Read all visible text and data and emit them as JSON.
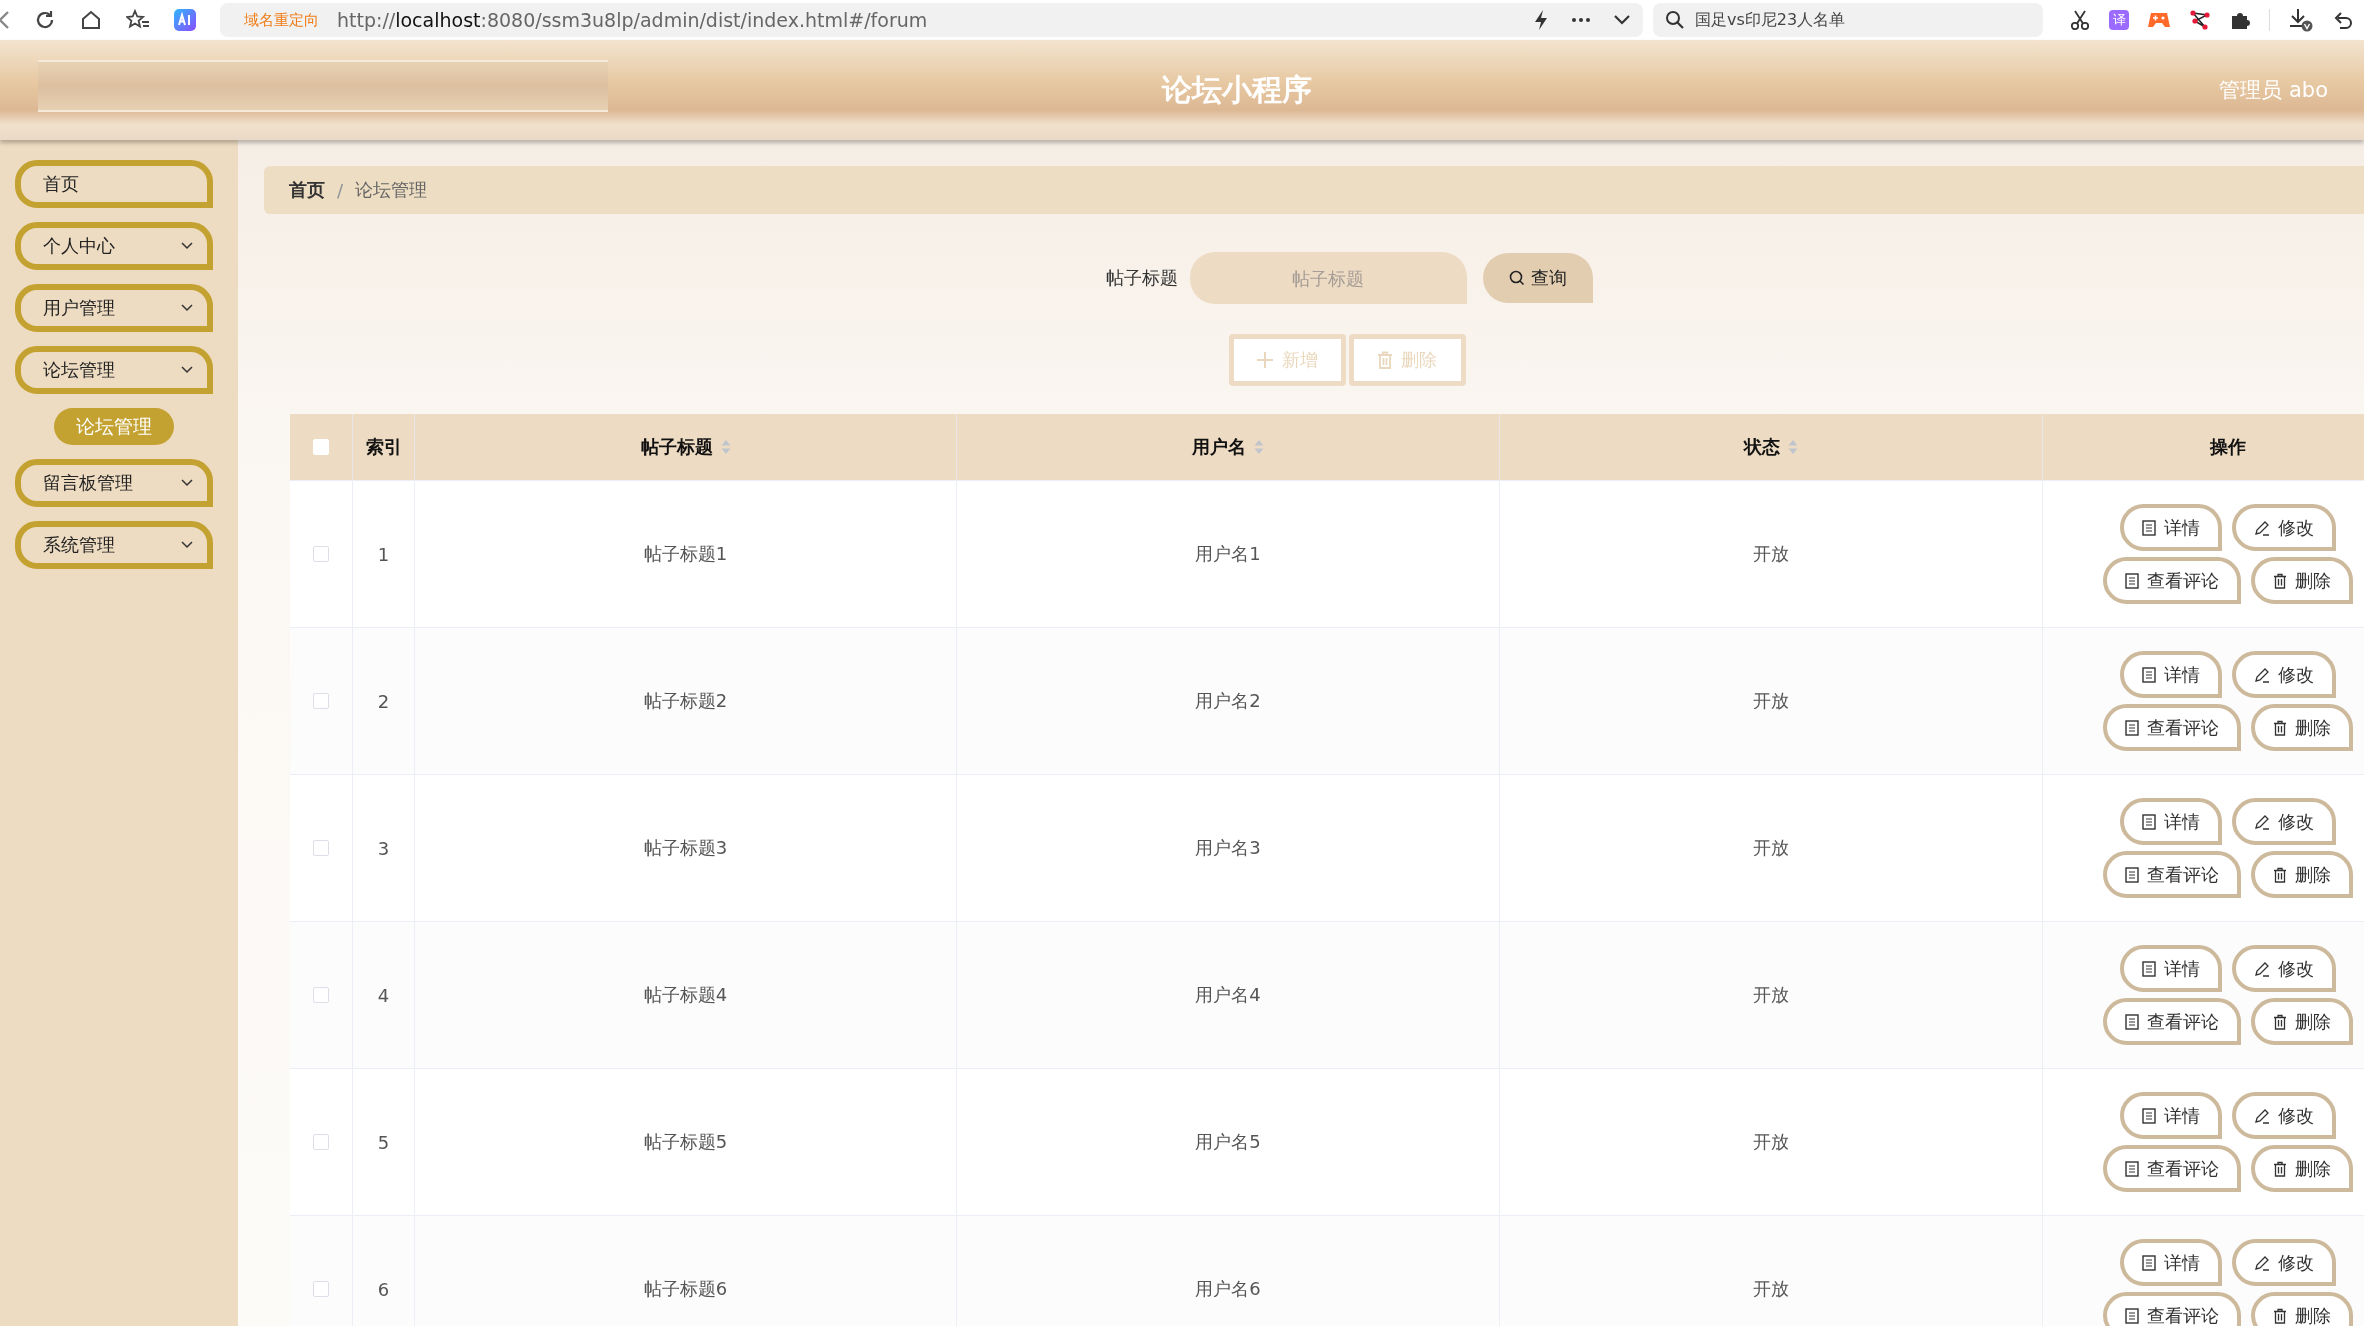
{
  "browser": {
    "redirect_label": "域名重定向",
    "url_scheme": "http://",
    "url_host": "localhost",
    "url_rest": ":8080/ssm3u8lp/admin/dist/index.html#/forum",
    "search": "国足vs印尼23人名单",
    "translate_label": "译"
  },
  "header": {
    "title": "论坛小程序",
    "user": "管理员 abo"
  },
  "sidebar": {
    "items": [
      {
        "label": "首页",
        "kind": "menu",
        "chevron": false,
        "selected": false
      },
      {
        "label": "个人中心",
        "kind": "menu",
        "chevron": true,
        "selected": false
      },
      {
        "label": "用户管理",
        "kind": "menu",
        "chevron": true,
        "selected": false
      },
      {
        "label": "论坛管理",
        "kind": "menu",
        "chevron": true,
        "selected": false
      },
      {
        "label": "论坛管理",
        "kind": "submenu",
        "selected": true
      },
      {
        "label": "留言板管理",
        "kind": "menu",
        "chevron": true,
        "selected": false
      },
      {
        "label": "系统管理",
        "kind": "menu",
        "chevron": true,
        "selected": false
      }
    ]
  },
  "breadcrumb": {
    "separator": "/",
    "items": [
      {
        "label": "首页",
        "current": false
      },
      {
        "label": "论坛管理",
        "current": true
      }
    ]
  },
  "search": {
    "label": "帖子标题",
    "placeholder": "帖子标题",
    "button": "查询"
  },
  "actions": [
    {
      "label": "新增",
      "kind": "add"
    },
    {
      "label": "删除",
      "kind": "delete"
    }
  ],
  "table": {
    "select_all_checked": false,
    "columns": [
      {
        "label": "索引",
        "sortable": false
      },
      {
        "label": "帖子标题",
        "sortable": true
      },
      {
        "label": "用户名",
        "sortable": true
      },
      {
        "label": "状态",
        "sortable": true
      },
      {
        "label": "操作",
        "sortable": false
      }
    ],
    "rows": [
      {
        "checked": false,
        "index": "1",
        "title": "帖子标题1",
        "username": "用户名1",
        "status": "开放",
        "actions": [
          {
            "label": "详情",
            "kind": "detail"
          },
          {
            "label": "修改",
            "kind": "edit"
          },
          {
            "label": "查看评论",
            "kind": "comments"
          },
          {
            "label": "删除",
            "kind": "delete"
          }
        ]
      },
      {
        "checked": false,
        "index": "2",
        "title": "帖子标题2",
        "username": "用户名2",
        "status": "开放",
        "actions": [
          {
            "label": "详情",
            "kind": "detail"
          },
          {
            "label": "修改",
            "kind": "edit"
          },
          {
            "label": "查看评论",
            "kind": "comments"
          },
          {
            "label": "删除",
            "kind": "delete"
          }
        ]
      },
      {
        "checked": false,
        "index": "3",
        "title": "帖子标题3",
        "username": "用户名3",
        "status": "开放",
        "actions": [
          {
            "label": "详情",
            "kind": "detail"
          },
          {
            "label": "修改",
            "kind": "edit"
          },
          {
            "label": "查看评论",
            "kind": "comments"
          },
          {
            "label": "删除",
            "kind": "delete"
          }
        ]
      },
      {
        "checked": false,
        "index": "4",
        "title": "帖子标题4",
        "username": "用户名4",
        "status": "开放",
        "actions": [
          {
            "label": "详情",
            "kind": "detail"
          },
          {
            "label": "修改",
            "kind": "edit"
          },
          {
            "label": "查看评论",
            "kind": "comments"
          },
          {
            "label": "删除",
            "kind": "delete"
          }
        ]
      },
      {
        "checked": false,
        "index": "5",
        "title": "帖子标题5",
        "username": "用户名5",
        "status": "开放",
        "actions": [
          {
            "label": "详情",
            "kind": "detail"
          },
          {
            "label": "修改",
            "kind": "edit"
          },
          {
            "label": "查看评论",
            "kind": "comments"
          },
          {
            "label": "删除",
            "kind": "delete"
          }
        ]
      },
      {
        "checked": false,
        "index": "6",
        "title": "帖子标题6",
        "username": "用户名6",
        "status": "开放",
        "actions": [
          {
            "label": "详情",
            "kind": "detail"
          },
          {
            "label": "修改",
            "kind": "edit"
          },
          {
            "label": "查看评论",
            "kind": "comments"
          },
          {
            "label": "删除",
            "kind": "delete"
          }
        ]
      }
    ]
  }
}
